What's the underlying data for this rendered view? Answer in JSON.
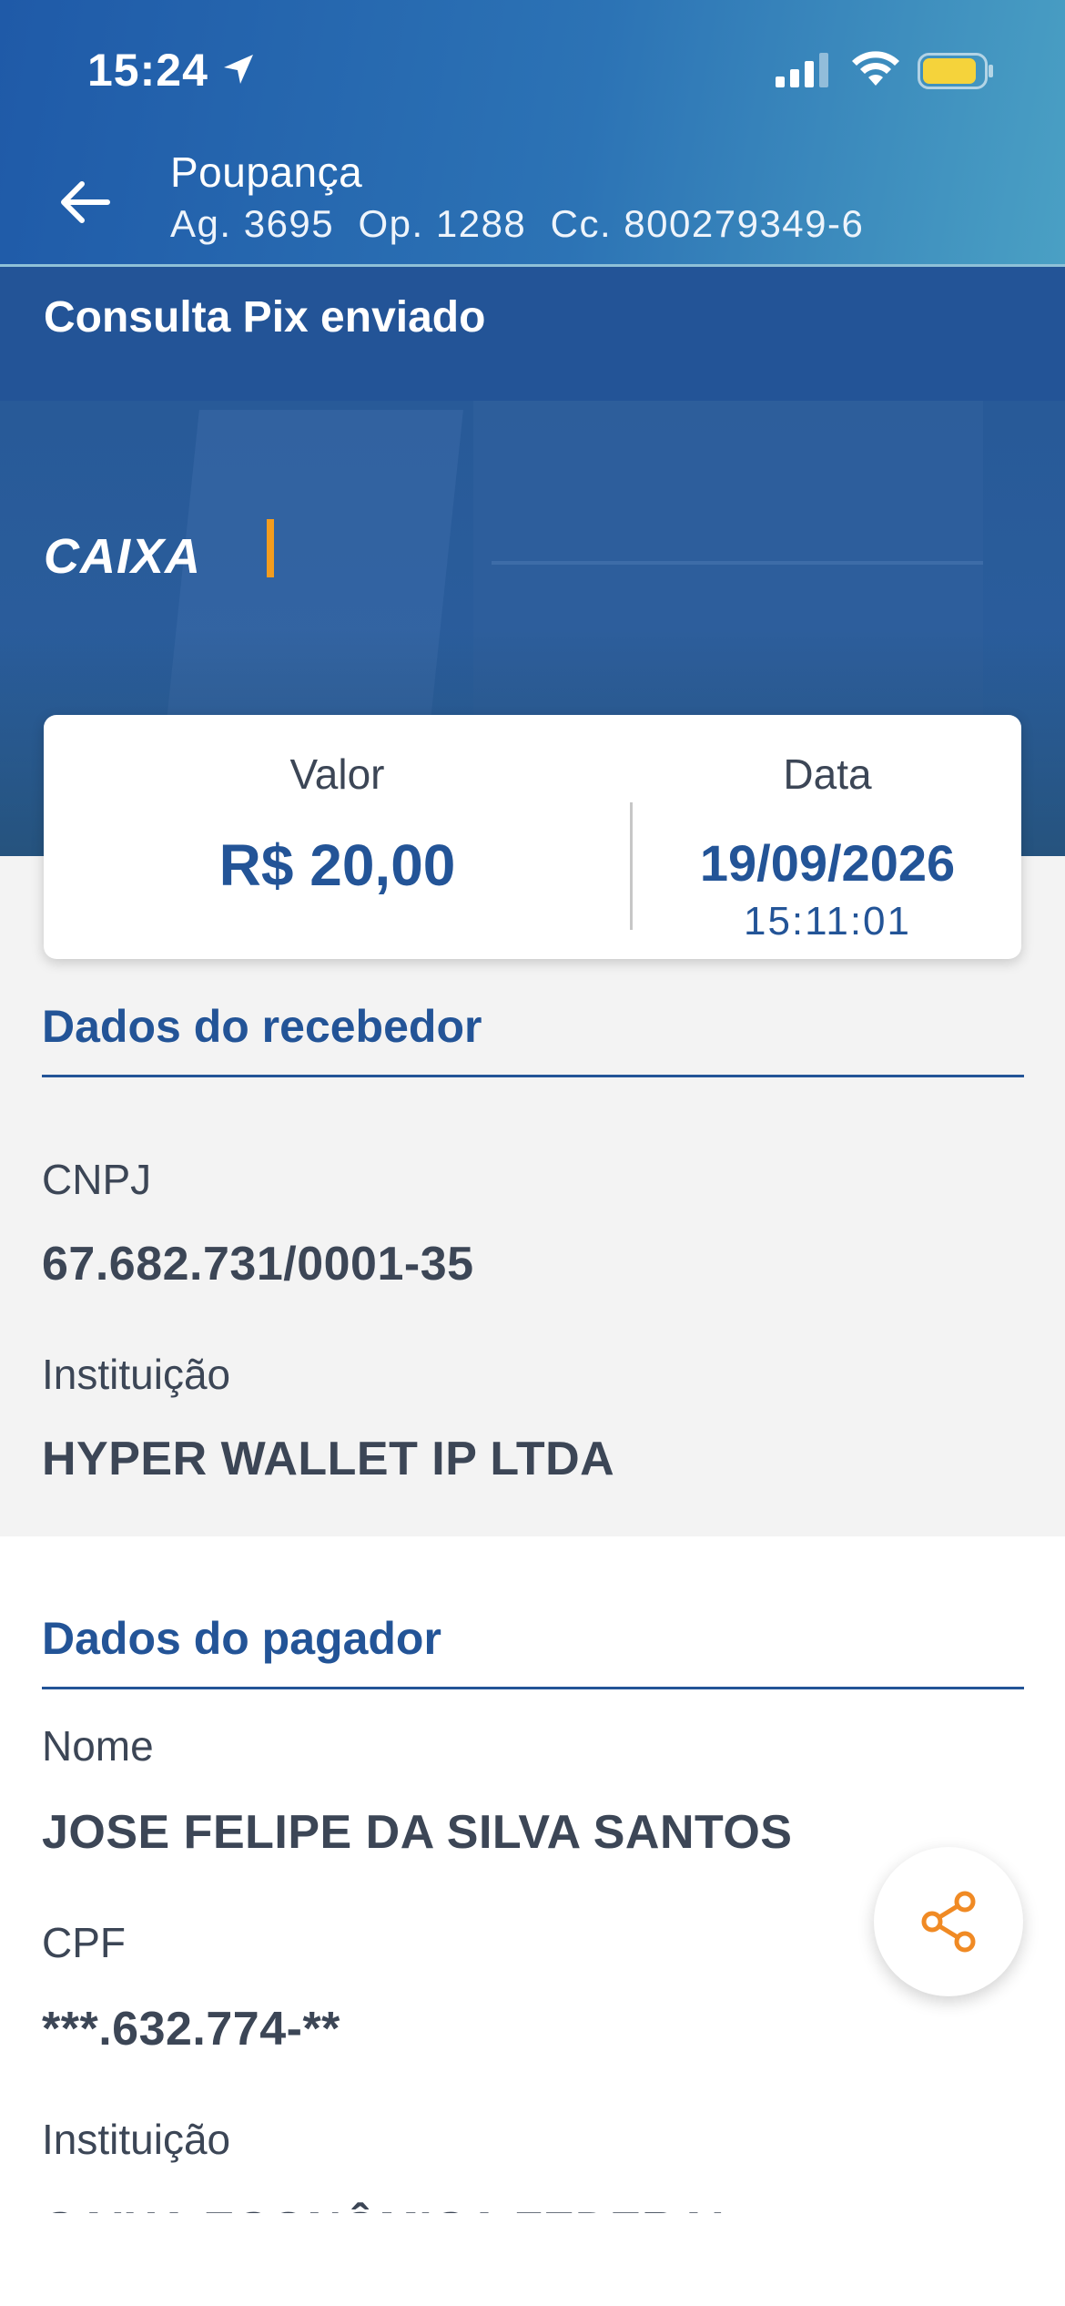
{
  "status_bar": {
    "time": "15:24",
    "icons": [
      "location-arrow-icon",
      "cellular-signal-icon",
      "wifi-icon",
      "battery-icon"
    ],
    "battery_color": "#f5d33b"
  },
  "header": {
    "back_icon": "arrow-left-icon",
    "account_name": "Poupança",
    "account_info": "Ag. 3695  Op. 1288  Cc. 800279349-6"
  },
  "page_title": "Consulta Pix enviado",
  "banner": {
    "logo_text": "CAIXA",
    "accent_color": "#f39c1e"
  },
  "summary": {
    "value_label": "Valor",
    "value": "R$ 20,00",
    "date_label": "Data",
    "date": "19/09/2026",
    "time": "15:11:01"
  },
  "receiver": {
    "title": "Dados do recebedor",
    "cnpj_label": "CNPJ",
    "cnpj_value": "67.682.731/0001-35",
    "institution_label": "Instituição",
    "institution_value": "HYPER WALLET IP LTDA"
  },
  "payer": {
    "title": "Dados do pagador",
    "name_label": "Nome",
    "name_value": "JOSE FELIPE DA SILVA SANTOS",
    "cpf_label": "CPF",
    "cpf_value": "***.632.774-**",
    "institution_label": "Instituição",
    "institution_value": "CAIXA ECONÔMICA FEDERAL"
  },
  "share_button": {
    "icon": "share-icon",
    "color": "#f08a24"
  },
  "colors": {
    "primary": "#235497",
    "text": "#3c4656",
    "background_grey": "#f3f3f3"
  }
}
